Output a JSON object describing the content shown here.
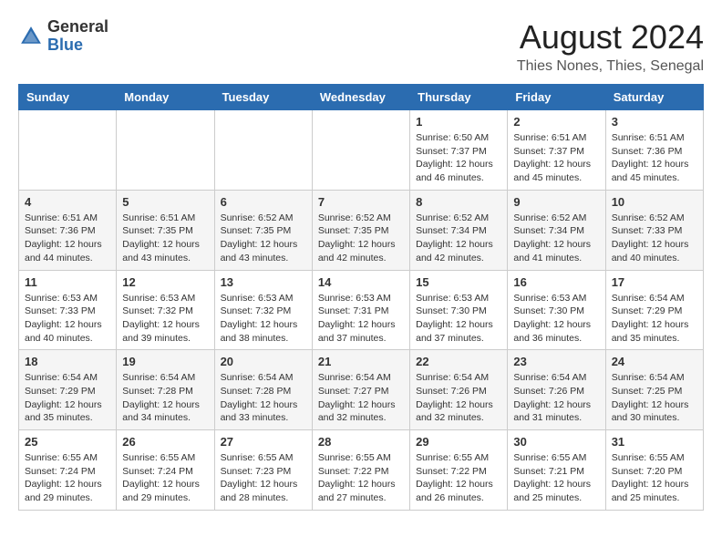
{
  "header": {
    "logo_general": "General",
    "logo_blue": "Blue",
    "month_title": "August 2024",
    "subtitle": "Thies Nones, Thies, Senegal"
  },
  "weekdays": [
    "Sunday",
    "Monday",
    "Tuesday",
    "Wednesday",
    "Thursday",
    "Friday",
    "Saturday"
  ],
  "weeks": [
    [
      {
        "day": "",
        "info": ""
      },
      {
        "day": "",
        "info": ""
      },
      {
        "day": "",
        "info": ""
      },
      {
        "day": "",
        "info": ""
      },
      {
        "day": "1",
        "info": "Sunrise: 6:50 AM\nSunset: 7:37 PM\nDaylight: 12 hours\nand 46 minutes."
      },
      {
        "day": "2",
        "info": "Sunrise: 6:51 AM\nSunset: 7:37 PM\nDaylight: 12 hours\nand 45 minutes."
      },
      {
        "day": "3",
        "info": "Sunrise: 6:51 AM\nSunset: 7:36 PM\nDaylight: 12 hours\nand 45 minutes."
      }
    ],
    [
      {
        "day": "4",
        "info": "Sunrise: 6:51 AM\nSunset: 7:36 PM\nDaylight: 12 hours\nand 44 minutes."
      },
      {
        "day": "5",
        "info": "Sunrise: 6:51 AM\nSunset: 7:35 PM\nDaylight: 12 hours\nand 43 minutes."
      },
      {
        "day": "6",
        "info": "Sunrise: 6:52 AM\nSunset: 7:35 PM\nDaylight: 12 hours\nand 43 minutes."
      },
      {
        "day": "7",
        "info": "Sunrise: 6:52 AM\nSunset: 7:35 PM\nDaylight: 12 hours\nand 42 minutes."
      },
      {
        "day": "8",
        "info": "Sunrise: 6:52 AM\nSunset: 7:34 PM\nDaylight: 12 hours\nand 42 minutes."
      },
      {
        "day": "9",
        "info": "Sunrise: 6:52 AM\nSunset: 7:34 PM\nDaylight: 12 hours\nand 41 minutes."
      },
      {
        "day": "10",
        "info": "Sunrise: 6:52 AM\nSunset: 7:33 PM\nDaylight: 12 hours\nand 40 minutes."
      }
    ],
    [
      {
        "day": "11",
        "info": "Sunrise: 6:53 AM\nSunset: 7:33 PM\nDaylight: 12 hours\nand 40 minutes."
      },
      {
        "day": "12",
        "info": "Sunrise: 6:53 AM\nSunset: 7:32 PM\nDaylight: 12 hours\nand 39 minutes."
      },
      {
        "day": "13",
        "info": "Sunrise: 6:53 AM\nSunset: 7:32 PM\nDaylight: 12 hours\nand 38 minutes."
      },
      {
        "day": "14",
        "info": "Sunrise: 6:53 AM\nSunset: 7:31 PM\nDaylight: 12 hours\nand 37 minutes."
      },
      {
        "day": "15",
        "info": "Sunrise: 6:53 AM\nSunset: 7:30 PM\nDaylight: 12 hours\nand 37 minutes."
      },
      {
        "day": "16",
        "info": "Sunrise: 6:53 AM\nSunset: 7:30 PM\nDaylight: 12 hours\nand 36 minutes."
      },
      {
        "day": "17",
        "info": "Sunrise: 6:54 AM\nSunset: 7:29 PM\nDaylight: 12 hours\nand 35 minutes."
      }
    ],
    [
      {
        "day": "18",
        "info": "Sunrise: 6:54 AM\nSunset: 7:29 PM\nDaylight: 12 hours\nand 35 minutes."
      },
      {
        "day": "19",
        "info": "Sunrise: 6:54 AM\nSunset: 7:28 PM\nDaylight: 12 hours\nand 34 minutes."
      },
      {
        "day": "20",
        "info": "Sunrise: 6:54 AM\nSunset: 7:28 PM\nDaylight: 12 hours\nand 33 minutes."
      },
      {
        "day": "21",
        "info": "Sunrise: 6:54 AM\nSunset: 7:27 PM\nDaylight: 12 hours\nand 32 minutes."
      },
      {
        "day": "22",
        "info": "Sunrise: 6:54 AM\nSunset: 7:26 PM\nDaylight: 12 hours\nand 32 minutes."
      },
      {
        "day": "23",
        "info": "Sunrise: 6:54 AM\nSunset: 7:26 PM\nDaylight: 12 hours\nand 31 minutes."
      },
      {
        "day": "24",
        "info": "Sunrise: 6:54 AM\nSunset: 7:25 PM\nDaylight: 12 hours\nand 30 minutes."
      }
    ],
    [
      {
        "day": "25",
        "info": "Sunrise: 6:55 AM\nSunset: 7:24 PM\nDaylight: 12 hours\nand 29 minutes."
      },
      {
        "day": "26",
        "info": "Sunrise: 6:55 AM\nSunset: 7:24 PM\nDaylight: 12 hours\nand 29 minutes."
      },
      {
        "day": "27",
        "info": "Sunrise: 6:55 AM\nSunset: 7:23 PM\nDaylight: 12 hours\nand 28 minutes."
      },
      {
        "day": "28",
        "info": "Sunrise: 6:55 AM\nSunset: 7:22 PM\nDaylight: 12 hours\nand 27 minutes."
      },
      {
        "day": "29",
        "info": "Sunrise: 6:55 AM\nSunset: 7:22 PM\nDaylight: 12 hours\nand 26 minutes."
      },
      {
        "day": "30",
        "info": "Sunrise: 6:55 AM\nSunset: 7:21 PM\nDaylight: 12 hours\nand 25 minutes."
      },
      {
        "day": "31",
        "info": "Sunrise: 6:55 AM\nSunset: 7:20 PM\nDaylight: 12 hours\nand 25 minutes."
      }
    ]
  ]
}
